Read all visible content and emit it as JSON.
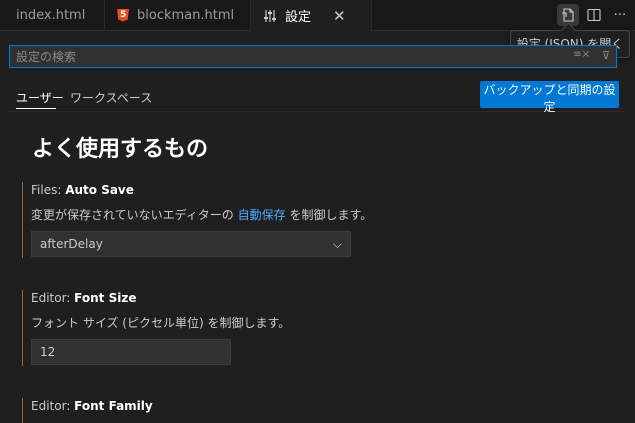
{
  "tabs": [
    {
      "label": "index.html",
      "icon": "html5-icon"
    },
    {
      "label": "blockman.html",
      "icon": "html5-icon"
    },
    {
      "label": "設定",
      "icon": "settings-sliders-icon",
      "active": true
    }
  ],
  "toolbar": {
    "tooltip": "設定 (JSON) を開く",
    "icons": [
      "open-settings-json-icon",
      "split-editor-icon",
      "more-actions-icon"
    ]
  },
  "search": {
    "placeholder": "設定の検索"
  },
  "scope_tabs": {
    "user": "ユーザー",
    "workspace": "ワークスペース"
  },
  "backup_button": "バックアップと同期の設定",
  "section_title": "よく使用するもの",
  "settings": [
    {
      "category": "Files: ",
      "name": "Auto Save",
      "desc_before": "変更が保存されていないエディターの ",
      "desc_link": "自動保存",
      "desc_after": " を制御します。",
      "value": "afterDelay"
    },
    {
      "category": "Editor: ",
      "name": "Font Size",
      "desc": "フォント サイズ (ピクセル単位) を制御します。",
      "value": "12"
    },
    {
      "category": "Editor: ",
      "name": "Font Family"
    }
  ],
  "colors": {
    "accent": "#0078d4",
    "link": "#4daafc",
    "modified_bar": "#8a6d3b"
  }
}
